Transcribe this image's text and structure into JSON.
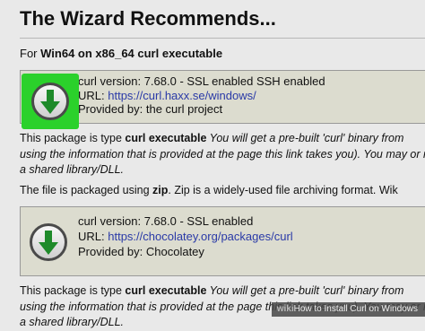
{
  "header": {
    "title": "The Wizard Recommends...",
    "subtitle_prefix": "For ",
    "subtitle_bold": "Win64 on x86_64 curl executable"
  },
  "package1": {
    "version": "curl version: 7.68.0 - SSL enabled SSH enabled",
    "url_label": "URL: ",
    "url": "https://curl.haxx.se/windows/",
    "provider": "Provided by: the curl project"
  },
  "para1": {
    "prefix": "This package is type ",
    "type": "curl executable",
    "italic_line1": " You will get a pre-built 'curl' binary from",
    "line2": "using the information that is provided at the page this link takes you). You may or may",
    "line3": "a shared library/DLL."
  },
  "para2": {
    "prefix": "The file is packaged using ",
    "format": "zip",
    "suffix": ". Zip is a widely-used file archiving format. Wik"
  },
  "package2": {
    "version": "curl version: 7.68.0 - SSL enabled",
    "url_label": "URL: ",
    "url": "https://chocolatey.org/packages/curl",
    "provider": "Provided by: Chocolatey"
  },
  "para3": {
    "prefix": "This package is type ",
    "type": "curl executable",
    "italic_line1": " You will get a pre-built 'curl' binary from",
    "line2": "using the information that is provided at the page this link takes you). You may or may",
    "line3": "a shared library/DLL."
  },
  "watermark": {
    "brand": "wiki",
    "text": "How to Install Curl on Windows"
  },
  "colors": {
    "highlight": "#2bd12b",
    "link": "#2a3aa7",
    "arrow": "#1e8a2a"
  },
  "icons": {
    "download": "download-arrow-icon"
  }
}
